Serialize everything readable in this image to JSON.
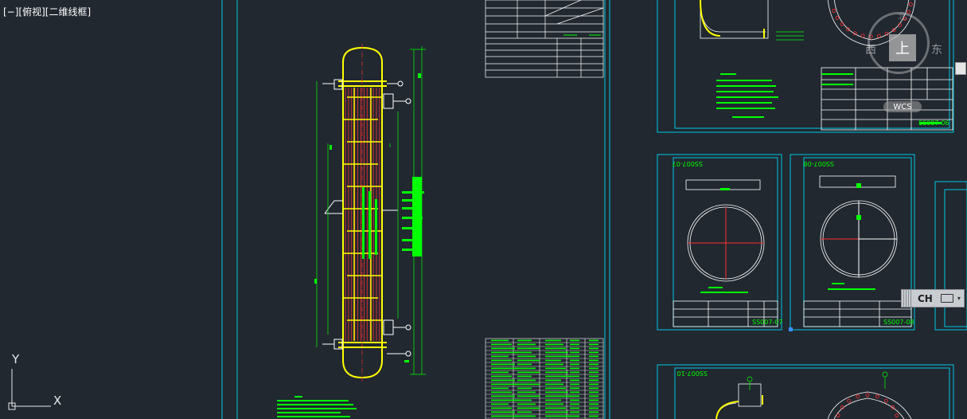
{
  "viewport": {
    "label": "[−][俯视][二维线框]"
  },
  "viewcube": {
    "top_face": "上",
    "west": "西",
    "east": "东",
    "north": "北"
  },
  "wcs": {
    "label": "WCS"
  },
  "ime_bar": {
    "mode": "CH",
    "menu_glyph": "▾"
  },
  "ucs": {
    "x_label": "X",
    "y_label": "Y"
  },
  "drawings": {
    "detail_07_ref": "SS007-07",
    "detail_08_ref": "SS007-08",
    "detail_10_ref": "SS007-10",
    "detail_06_ref": "SS007-06"
  },
  "colors": {
    "background": "#212830",
    "frame": "#00c8e6",
    "geometry": "#ffffff",
    "vessel": "#ffff00",
    "annotation": "#00ff00",
    "tubes": "#ff2020",
    "accent": "#ff00ff"
  }
}
